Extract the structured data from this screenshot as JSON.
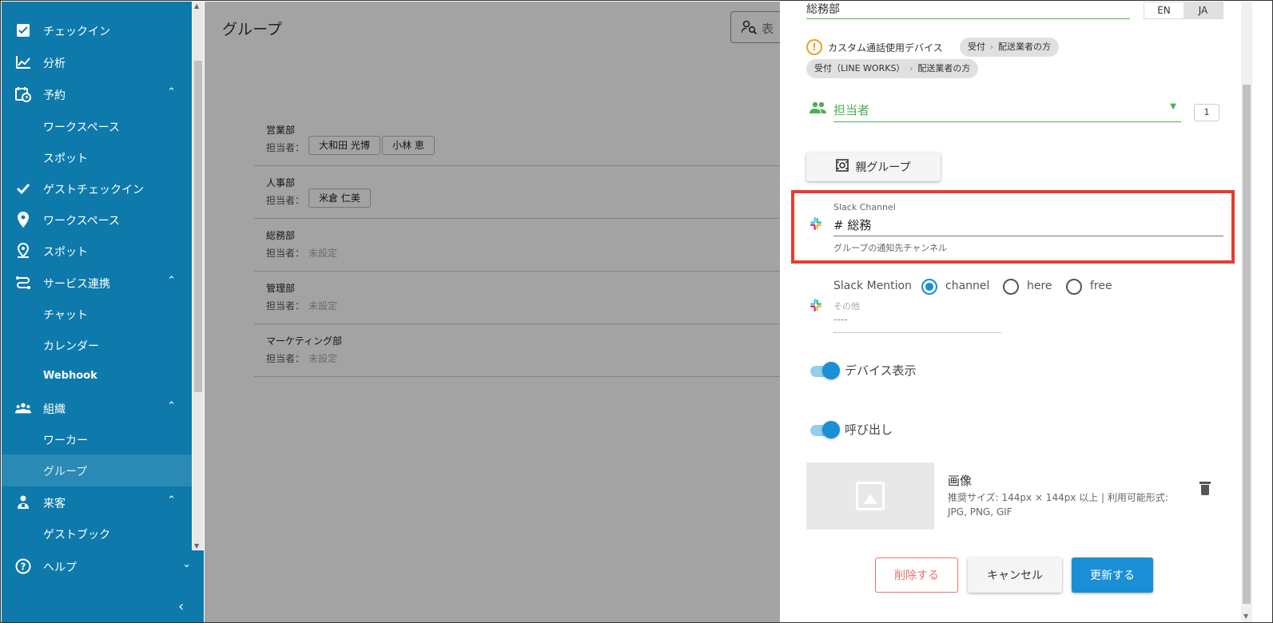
{
  "sidebar": {
    "items": [
      {
        "label": "チェックイン",
        "icon": "checkbox-icon"
      },
      {
        "label": "分析",
        "icon": "chart-line-icon"
      },
      {
        "label": "予約",
        "icon": "calendar-clock-icon",
        "expanded": true
      },
      {
        "label": "ワークスペース",
        "sub": true
      },
      {
        "label": "スポット",
        "sub": true
      },
      {
        "label": "ゲストチェックイン",
        "icon": "check-icon"
      },
      {
        "label": "ワークスペース",
        "icon": "map-pin-icon"
      },
      {
        "label": "スポット",
        "icon": "person-pin-icon"
      },
      {
        "label": "サービス連携",
        "icon": "integration-icon",
        "expanded": true
      },
      {
        "label": "チャット",
        "sub": true
      },
      {
        "label": "カレンダー",
        "sub": true
      },
      {
        "label": "Webhook",
        "sub": true
      },
      {
        "label": "組織",
        "icon": "people-icon",
        "expanded": true
      },
      {
        "label": "ワーカー",
        "sub": true
      },
      {
        "label": "グループ",
        "sub": true,
        "selected": true
      },
      {
        "label": "来客",
        "icon": "visitor-icon",
        "expanded": true
      },
      {
        "label": "ゲストブック",
        "sub": true
      },
      {
        "label": "ヘルプ",
        "icon": "help-icon"
      }
    ]
  },
  "main": {
    "title": "グループ",
    "search_placeholder": "表",
    "assignee_label": "担当者：",
    "unset_label": "未設定",
    "groups": [
      {
        "name": "営業部",
        "members": [
          "大和田 光博",
          "小林 恵"
        ]
      },
      {
        "name": "人事部",
        "members": [
          "米倉 仁美"
        ]
      },
      {
        "name": "総務部",
        "members": []
      },
      {
        "name": "管理部",
        "members": []
      },
      {
        "name": "マーケティング部",
        "members": []
      }
    ]
  },
  "drawer": {
    "group_name": "総務部",
    "lang_en": "EN",
    "lang_ja": "JA",
    "custom_device_label": "カスタム通話使用デバイス",
    "flows": [
      {
        "from": "受付",
        "to": "配送業者の方"
      },
      {
        "from": "受付（LINE WORKS）",
        "to": "配送業者の方"
      }
    ],
    "assignee_field": "担当者",
    "assignee_count": "1",
    "parent_group_button": "親グループ",
    "slack_channel": {
      "label": "Slack Channel",
      "value": "# 総務",
      "hint": "グループの通知先チャンネル"
    },
    "slack_mention": {
      "label": "Slack Mention",
      "options": [
        "channel",
        "here",
        "free"
      ],
      "selected": "channel",
      "other_label": "その他",
      "other_value": "----"
    },
    "device_display_label": "デバイス表示",
    "call_label": "呼び出し",
    "image": {
      "title": "画像",
      "description": "推奨サイズ: 144px × 144px 以上 | 利用可能形式: JPG, PNG, GIF"
    },
    "buttons": {
      "delete": "削除する",
      "cancel": "キャンセル",
      "update": "更新する"
    }
  },
  "colors": {
    "sidebar_bg": "#0e7aab",
    "accent_green": "#4caf50",
    "primary_blue": "#1a8fd6",
    "highlight_red": "#e63c30"
  }
}
